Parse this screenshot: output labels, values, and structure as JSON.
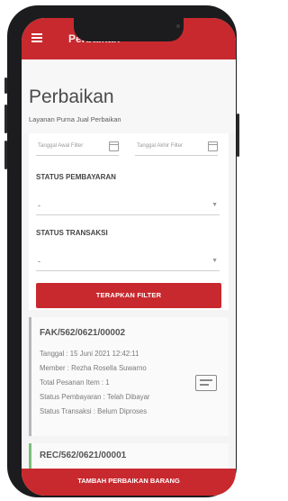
{
  "app_bar": {
    "title": "Perbaikan",
    "menu_icon": "hamburger-icon"
  },
  "header": {
    "title": "Perbaikan",
    "subtitle": "Layanan Purna Jual Perbaikan"
  },
  "filters": {
    "date_start_placeholder": "Tanggal Awal Filter",
    "date_end_placeholder": "Tanggal Akhir Filter",
    "payment_status_label": "STATUS PEMBAYARAN",
    "payment_status_value": "-",
    "transaction_status_label": "STATUS TRANSAKSI",
    "transaction_status_value": "-",
    "apply_label": "TERAPKAN FILTER"
  },
  "orders": [
    {
      "code": "FAK/562/0621/00002",
      "date": "Tanggal : 15 Juni 2021 12:42:11",
      "member": "Member : Rezha Rosella Suwarno",
      "total_items": "Total Pesanan Item : 1",
      "payment_status": "Status Pembayaran : Telah Dibayar",
      "transaction_status": "Status Transaksi : Belum Diproses",
      "icon": "receipt-icon"
    },
    {
      "code": "REC/562/0621/00001"
    }
  ],
  "footer": {
    "add_label": "TAMBAH PERBAIKAN BARANG"
  },
  "colors": {
    "brand_red": "#c8292e"
  }
}
